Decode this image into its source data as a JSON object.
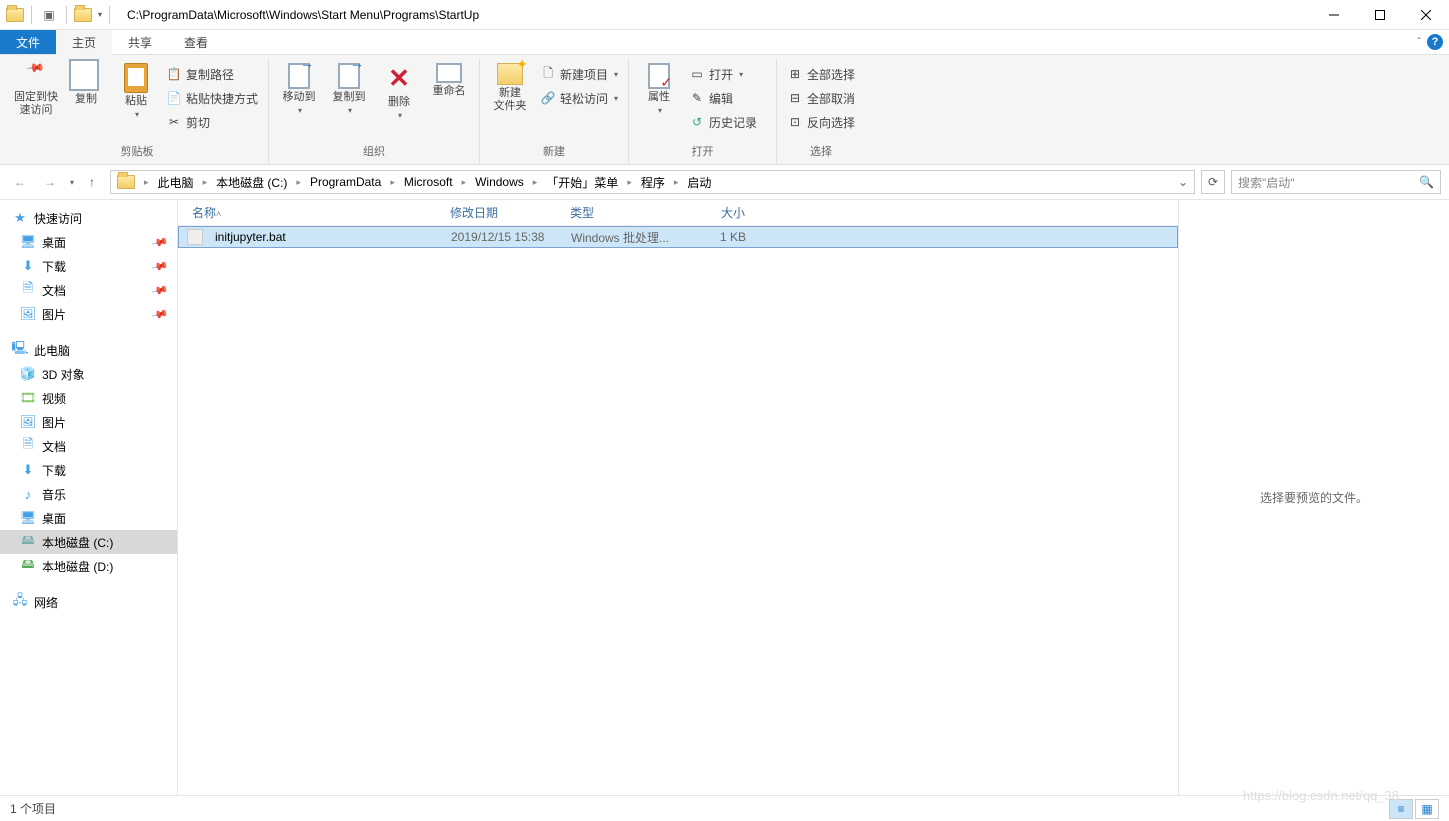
{
  "title_path": "C:\\ProgramData\\Microsoft\\Windows\\Start Menu\\Programs\\StartUp",
  "tabs": {
    "file": "文件",
    "home": "主页",
    "share": "共享",
    "view": "查看"
  },
  "ribbon": {
    "clipboard": {
      "pin": "固定到快\n速访问",
      "copy": "复制",
      "paste": "粘贴",
      "copy_path": "复制路径",
      "paste_shortcut": "粘贴快捷方式",
      "cut": "剪切",
      "group": "剪贴板"
    },
    "organize": {
      "move": "移动到",
      "copy_to": "复制到",
      "delete": "删除",
      "rename": "重命名",
      "group": "组织"
    },
    "new": {
      "folder": "新建\n文件夹",
      "item": "新建项目",
      "easy": "轻松访问",
      "group": "新建"
    },
    "open": {
      "props": "属性",
      "open": "打开",
      "edit": "编辑",
      "history": "历史记录",
      "group": "打开"
    },
    "select": {
      "all": "全部选择",
      "none": "全部取消",
      "invert": "反向选择",
      "group": "选择"
    }
  },
  "breadcrumbs": [
    "此电脑",
    "本地磁盘 (C:)",
    "ProgramData",
    "Microsoft",
    "Windows",
    "「开始」菜单",
    "程序",
    "启动"
  ],
  "search_placeholder": "搜索\"启动\"",
  "sidebar": {
    "quick": "快速访问",
    "desktop": "桌面",
    "downloads": "下载",
    "documents": "文档",
    "pictures": "图片",
    "thispc": "此电脑",
    "obj3d": "3D 对象",
    "videos": "视频",
    "pictures2": "图片",
    "docs2": "文档",
    "downloads2": "下载",
    "music": "音乐",
    "desktop2": "桌面",
    "drive_c": "本地磁盘 (C:)",
    "drive_d": "本地磁盘 (D:)",
    "network": "网络"
  },
  "columns": {
    "name": "名称",
    "date": "修改日期",
    "type": "类型",
    "size": "大小"
  },
  "files": [
    {
      "name": "initjupyter.bat",
      "date": "2019/12/15 15:38",
      "type": "Windows 批处理...",
      "size": "1 KB"
    }
  ],
  "preview_text": "选择要预览的文件。",
  "status": "1 个项目",
  "watermark": "https://blog.csdn.net/qq_38"
}
